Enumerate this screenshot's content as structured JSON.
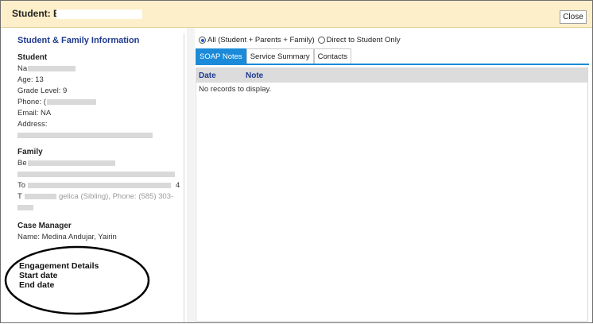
{
  "window": {
    "title": "Student: Berno",
    "close_label": "Close"
  },
  "left": {
    "section_title": "Student & Family Information",
    "student": {
      "heading": "Student",
      "name_label": "Na",
      "age": "Age: 13",
      "grade": "Grade Level: 9",
      "phone": "Phone: (",
      "email": "Email: NA",
      "address_label": "Address:"
    },
    "family": {
      "heading": "Family",
      "member1": "Be",
      "member2": "To",
      "member2_end": "4",
      "member3": "T",
      "member3_mid": "gelica (Sibling), Phone: (585) 303-"
    },
    "case_manager": {
      "heading": "Case Manager",
      "name": "Name: Medina Andujar, Yairin"
    },
    "engagement": {
      "heading": "Engagement Details",
      "start": "Start date",
      "end": "End date"
    }
  },
  "right": {
    "filter_all": "All (Student + Parents + Family)",
    "filter_direct": "Direct to Student Only",
    "tabs": [
      {
        "label": "SOAP Notes"
      },
      {
        "label": "Service Summary"
      },
      {
        "label": "Contacts"
      }
    ],
    "grid": {
      "columns": [
        "Date",
        "Note"
      ],
      "empty_message": "No records to display."
    }
  },
  "colors": {
    "titlebar": "#fdefc9",
    "heading_blue": "#1f3a8f",
    "tab_active": "#1b8ad8",
    "grid_header": "#dcdcdc"
  }
}
